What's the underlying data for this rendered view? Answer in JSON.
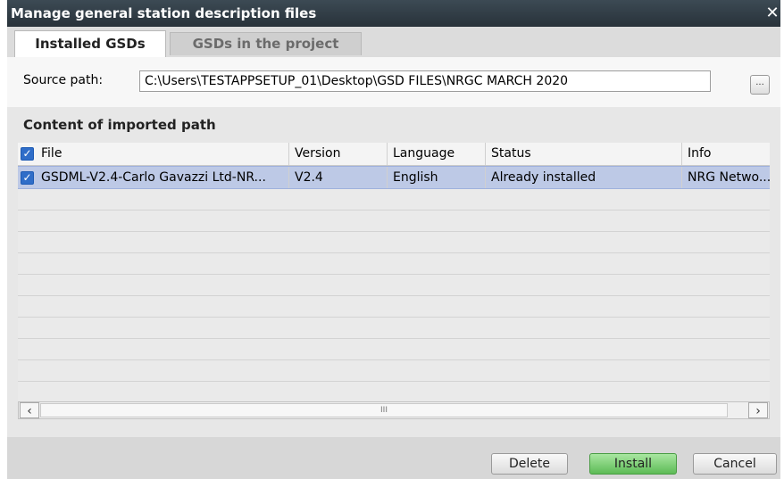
{
  "window": {
    "title": "Manage general station description files",
    "close_glyph": "✕"
  },
  "tabs": [
    {
      "label": "Installed GSDs",
      "active": true
    },
    {
      "label": "GSDs in the project",
      "active": false
    }
  ],
  "source": {
    "label": "Source path:",
    "value": "C:\\Users\\TESTAPPSETUP_01\\Desktop\\GSD FILES\\NRGC MARCH 2020",
    "browse_label": "..."
  },
  "content": {
    "section_title": "Content of imported path",
    "columns": [
      "File",
      "Version",
      "Language",
      "Status",
      "Info"
    ],
    "rows": [
      {
        "checked": true,
        "file": "GSDML-V2.4-Carlo Gavazzi Ltd-NR...",
        "version": "V2.4",
        "language": "English",
        "status": "Already installed",
        "info": "NRG Netwo..."
      }
    ],
    "scroll_thumb_glyph": "III"
  },
  "buttons": {
    "delete": "Delete",
    "install": "Install",
    "cancel": "Cancel"
  },
  "colors": {
    "titlebar": "#28323a",
    "selection": "#bdc9e6",
    "install_button": "#5dbb56",
    "checkbox": "#2f6dc8"
  },
  "icons": {
    "close": "close-icon",
    "browse": "ellipsis-icon",
    "scroll_left": "chevron-left-icon",
    "scroll_right": "chevron-right-icon"
  }
}
